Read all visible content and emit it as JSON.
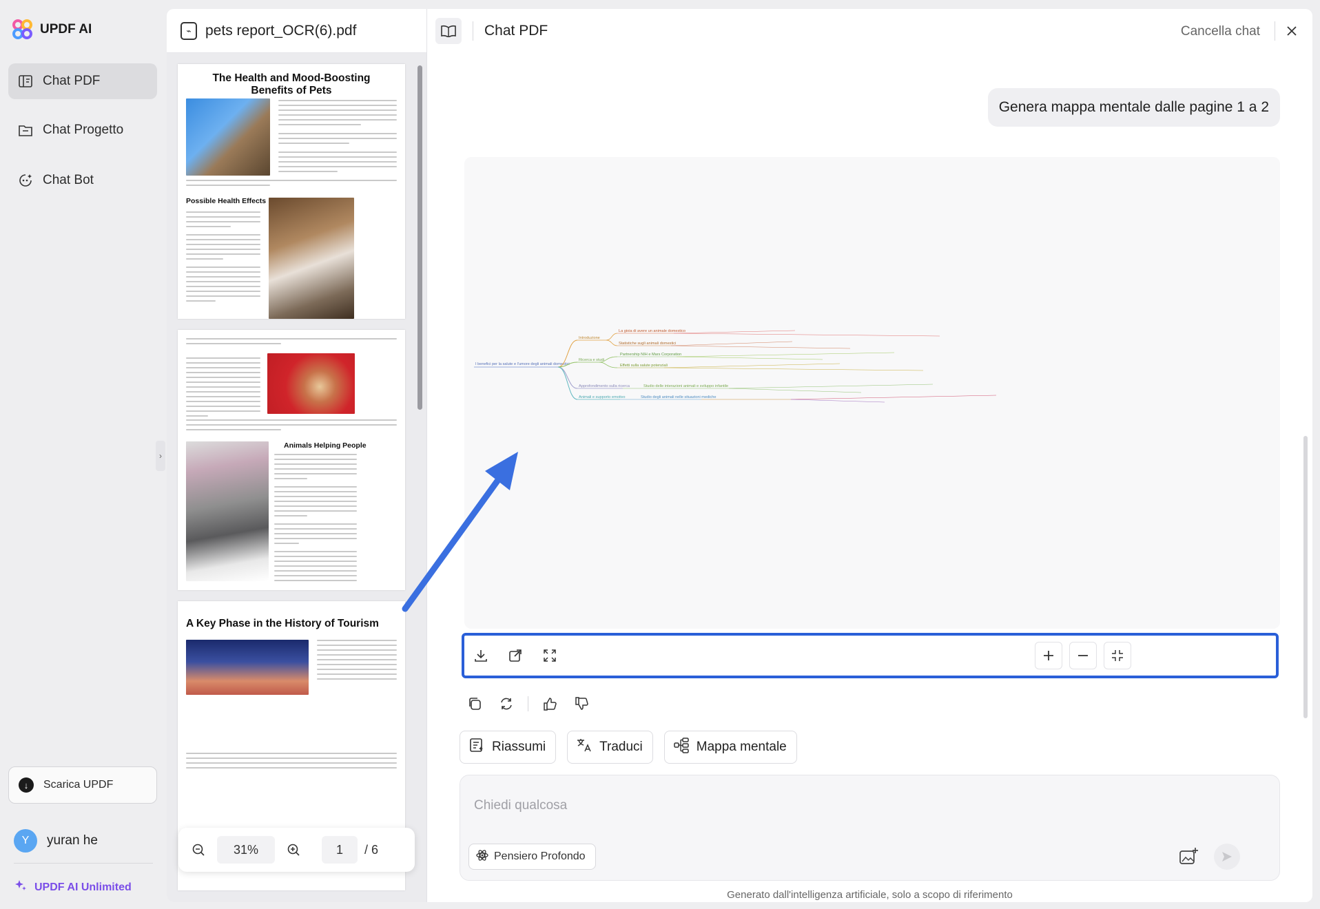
{
  "app": {
    "brand": "UPDF AI",
    "nav": [
      {
        "label": "Chat PDF",
        "icon": "chat-pdf-icon",
        "active": true
      },
      {
        "label": "Chat Progetto",
        "icon": "folder-chat-icon",
        "active": false
      },
      {
        "label": "Chat Bot",
        "icon": "bot-icon",
        "active": false
      }
    ],
    "download_label": "Scarica UPDF",
    "user": {
      "initial": "Y",
      "name": "yuran he"
    },
    "plan": "UPDF AI Unlimited"
  },
  "pdf": {
    "filename": "pets report_OCR(6).pdf",
    "pages": [
      {
        "title": "The Health and Mood-Boosting Benefits of Pets",
        "section": "Possible Health Effects"
      },
      {
        "section": "Animals Helping People"
      },
      {
        "title": "A Key Phase in the History of Tourism"
      }
    ],
    "zoom": "31%",
    "current_page": "1",
    "total_pages": "/ 6"
  },
  "chat": {
    "title": "Chat PDF",
    "cancel_label": "Cancella chat",
    "user_message": "Genera mappa mentale dalle pagine 1 a 2",
    "mindmap": {
      "root": "I benefici per la salute e l'umore degli animali domestici",
      "branches": [
        {
          "label": "Introduzione",
          "children": [
            "La gioia di avere un animale domestico",
            "Statistiche sugli animali domestici"
          ]
        },
        {
          "label": "Ricerca e studi",
          "children": [
            "Partnership NIH e Mars Corporation",
            "Effetti sulla salute potenziali"
          ]
        },
        {
          "label": "Approfondimento sulla ricerca",
          "children": [
            "Studio delle interazioni animali e sviluppo infantile"
          ]
        },
        {
          "label": "Animali e supporto emotivo",
          "children": [
            "Studio degli animali nelle situazioni mediche"
          ]
        }
      ]
    },
    "actions": [
      {
        "label": "Riassumi",
        "icon": "summary-icon"
      },
      {
        "label": "Traduci",
        "icon": "translate-icon"
      },
      {
        "label": "Mappa mentale",
        "icon": "mindmap-icon"
      }
    ],
    "input_placeholder": "Chiedi qualcosa",
    "deep_think_label": "Pensiero Profondo",
    "footer": "Generato dall'intelligenza artificiale, solo a scopo di riferimento"
  },
  "colors": {
    "accent": "#2a5fd8",
    "arrow": "#3a6fe0",
    "plan": "#7a4de8"
  }
}
